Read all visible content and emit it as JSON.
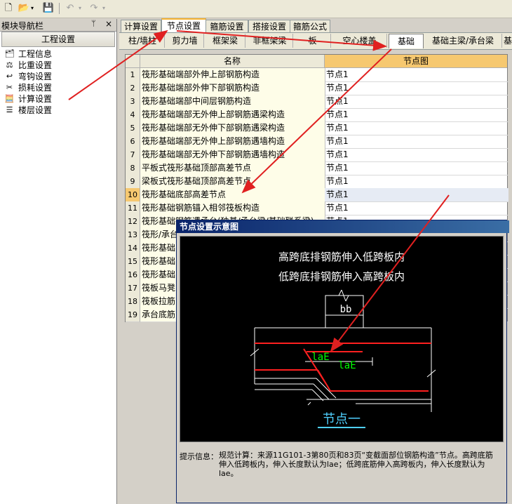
{
  "toolbar": {
    "icons": [
      "new-icon",
      "open-icon",
      "dropdown-icon",
      "save-icon",
      "undo-icon",
      "undo-dropdown-icon",
      "redo-icon",
      "redo-dropdown-icon"
    ]
  },
  "nav": {
    "title": "模块导航栏",
    "pin": "ᛘ",
    "close": "×",
    "header": "工程设置",
    "items": [
      {
        "label": "工程信息",
        "icon": "project-info-icon"
      },
      {
        "label": "比重设置",
        "icon": "density-icon"
      },
      {
        "label": "弯钩设置",
        "icon": "hook-icon"
      },
      {
        "label": "损耗设置",
        "icon": "loss-icon"
      },
      {
        "label": "计算设置",
        "icon": "calc-icon"
      },
      {
        "label": "楼层设置",
        "icon": "floor-icon"
      }
    ]
  },
  "tabs": [
    "计算设置",
    "节点设置",
    "箍筋设置",
    "搭接设置",
    "箍筋公式"
  ],
  "active_tab": 1,
  "subtabs": [
    "柱/墙柱",
    "剪力墙",
    "框架梁",
    "非框架梁",
    "板",
    "空心楼盖",
    "基础",
    "基础主梁/承台梁",
    "基"
  ],
  "active_subtab": 6,
  "grid": {
    "col_name": "名称",
    "col_node": "节点图",
    "rows": [
      {
        "n": "1",
        "name": "筏形基础端部外伸上部钢筋构造",
        "node": "节点1"
      },
      {
        "n": "2",
        "name": "筏形基础端部外伸下部钢筋构造",
        "node": "节点1"
      },
      {
        "n": "3",
        "name": "筏形基础端部中间层钢筋构造",
        "node": "节点1"
      },
      {
        "n": "4",
        "name": "筏形基础端部无外伸上部钢筋遇梁构造",
        "node": "节点1"
      },
      {
        "n": "5",
        "name": "筏形基础端部无外伸下部钢筋遇梁构造",
        "node": "节点1"
      },
      {
        "n": "6",
        "name": "筏形基础端部无外伸上部钢筋遇墙构造",
        "node": "节点1"
      },
      {
        "n": "7",
        "name": "筏形基础端部无外伸下部钢筋遇墙构造",
        "node": "节点1"
      },
      {
        "n": "8",
        "name": "平板式筏形基础顶部高差节点",
        "node": "节点1"
      },
      {
        "n": "9",
        "name": "梁板式筏形基础顶部高差节点",
        "node": "节点1"
      },
      {
        "n": "10",
        "name": "筏形基础底部高差节点",
        "node": "节点1"
      },
      {
        "n": "11",
        "name": "筏形基础钢筋锚入相邻筏板构造",
        "node": "节点1"
      },
      {
        "n": "12",
        "name": "筏形基础钢筋遇承台(独基/承台梁/基础联系梁)",
        "node": "节点1"
      },
      {
        "n": "13",
        "name": "筏形/承台",
        "node": ""
      },
      {
        "n": "14",
        "name": "筏形基础",
        "node": ""
      },
      {
        "n": "15",
        "name": "筏形基础",
        "node": ""
      },
      {
        "n": "16",
        "name": "筏形基础",
        "node": ""
      },
      {
        "n": "17",
        "name": "筏板马凳",
        "node": ""
      },
      {
        "n": "18",
        "name": "筏板拉筋",
        "node": ""
      },
      {
        "n": "19",
        "name": "承台底筋",
        "node": ""
      }
    ],
    "highlight_row": 9
  },
  "dialog": {
    "title": "节点设置示意图",
    "line1": "高跨底排钢筋伸入低跨板内",
    "line2": "低跨底排钢筋伸入高跨板内",
    "label_bb": "bb",
    "label_lae1": "laE",
    "label_lae2": "laE",
    "node_label": "节点一",
    "info_label": "提示信息：",
    "info_text": "规范计算：来源11G101-3第80页和83页“变截面部位钢筋构造”节点。高跨底筋伸入低跨板内，伸入长度默认为lae；低跨底筋伸入高跨板内，伸入长度默认为lae。"
  },
  "colors": {
    "accent": "#f7b432",
    "arrow": "#e02020",
    "rebar": "#ff2020",
    "label_green": "#00ff00",
    "node_cyan": "#4fd0ff"
  }
}
